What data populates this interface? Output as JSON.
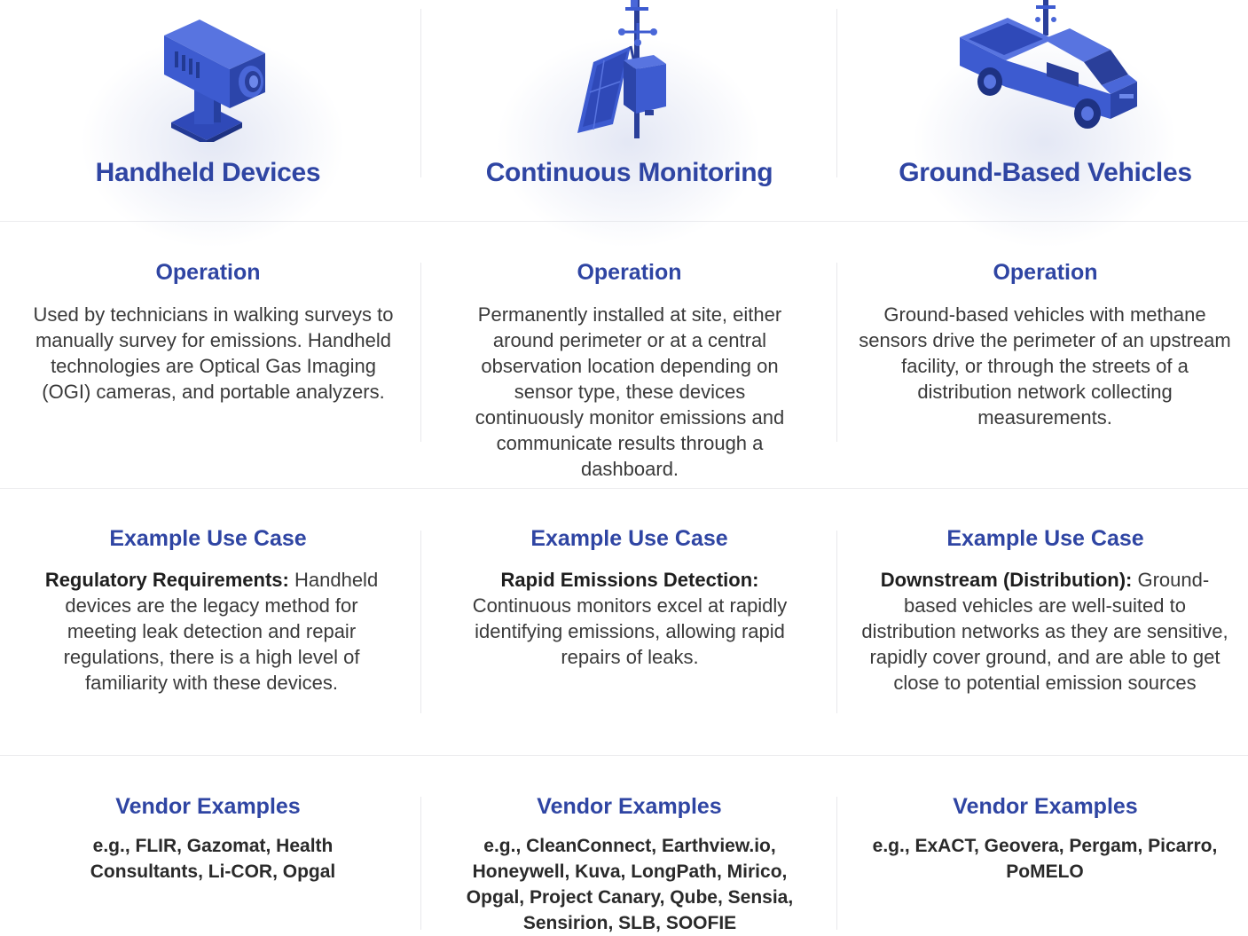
{
  "columns": [
    {
      "title": "Handheld Devices",
      "icon": "handheld-camera-icon",
      "operation_heading": "Operation",
      "operation_text": "Used by technicians in walking surveys to manually survey for emissions. Handheld technologies are Optical Gas Imaging (OGI) cameras, and portable analyzers.",
      "use_case_heading": "Example Use Case",
      "use_case_lead": "Regulatory Requirements:",
      "use_case_text": " Handheld devices are the legacy method for meeting leak detection and repair regulations, there is a high level of familiarity with these devices.",
      "vendor_heading": "Vendor Examples",
      "vendor_text": "e.g., FLIR, Gazomat, Health Consultants, Li-COR, Opgal"
    },
    {
      "title": "Continuous Monitoring",
      "icon": "monitoring-station-icon",
      "operation_heading": "Operation",
      "operation_text": "Permanently installed at site, either around perimeter or at a central observation location depending on sensor type, these devices continuously monitor emissions and communicate results through a dashboard.",
      "use_case_heading": "Example Use Case",
      "use_case_lead": "Rapid Emissions Detection:",
      "use_case_text": " Continuous monitors excel at rapidly identifying emissions, allowing rapid repairs of leaks.",
      "vendor_heading": "Vendor Examples",
      "vendor_text": "e.g., CleanConnect, Earthview.io, Honeywell, Kuva, LongPath, Mirico, Opgal, Project Canary, Qube, Sensia, Sensirion, SLB, SOOFIE"
    },
    {
      "title": "Ground-Based Vehicles",
      "icon": "pickup-truck-icon",
      "operation_heading": "Operation",
      "operation_text": "Ground-based vehicles with methane sensors drive the perimeter of an upstream facility, or through the streets of a distribution network collecting measurements.",
      "use_case_heading": "Example Use Case",
      "use_case_lead": "Downstream (Distribution):",
      "use_case_text": " Ground-based vehicles are well-suited to distribution networks as they are sensitive, rapidly cover ground, and are able to get close to potential emission sources",
      "vendor_heading": "Vendor Examples",
      "vendor_text": "e.g., ExACT, Geovera, Pergam, Picarro, PoMELO"
    }
  ],
  "colors": {
    "accent": "#2f45a3",
    "icon_blue": "#3d5bd0",
    "icon_dark": "#2a3f9a"
  }
}
